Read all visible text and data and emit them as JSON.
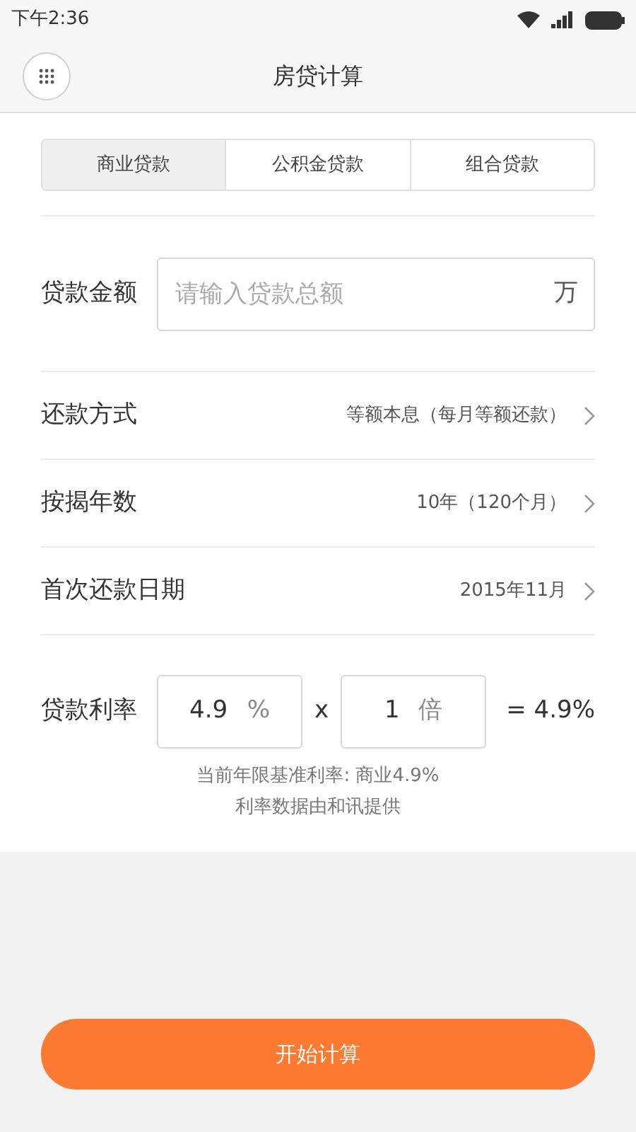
{
  "status_bar": {
    "time": "下午2:36"
  },
  "header": {
    "title": "房贷计算"
  },
  "tabs": [
    {
      "label": "商业贷款",
      "selected": true
    },
    {
      "label": "公积金贷款",
      "selected": false
    },
    {
      "label": "组合贷款",
      "selected": false
    }
  ],
  "loan_amount": {
    "label": "贷款金额",
    "placeholder": "请输入贷款总额",
    "unit": "万"
  },
  "options": [
    {
      "label": "还款方式",
      "value": "等额本息（每月等额还款）"
    },
    {
      "label": "按揭年数",
      "value": "10年（120个月）"
    },
    {
      "label": "首次还款日期",
      "value": "2015年11月"
    }
  ],
  "rate": {
    "label": "贷款利率",
    "base": "4.9",
    "base_unit": "%",
    "operator": "x",
    "multiplier": "1",
    "multiplier_unit": "倍",
    "result": "= 4.9%"
  },
  "notes": [
    "当前年限基准利率: 商业4.9%",
    "利率数据由和讯提供"
  ],
  "start_button": "开始计算"
}
